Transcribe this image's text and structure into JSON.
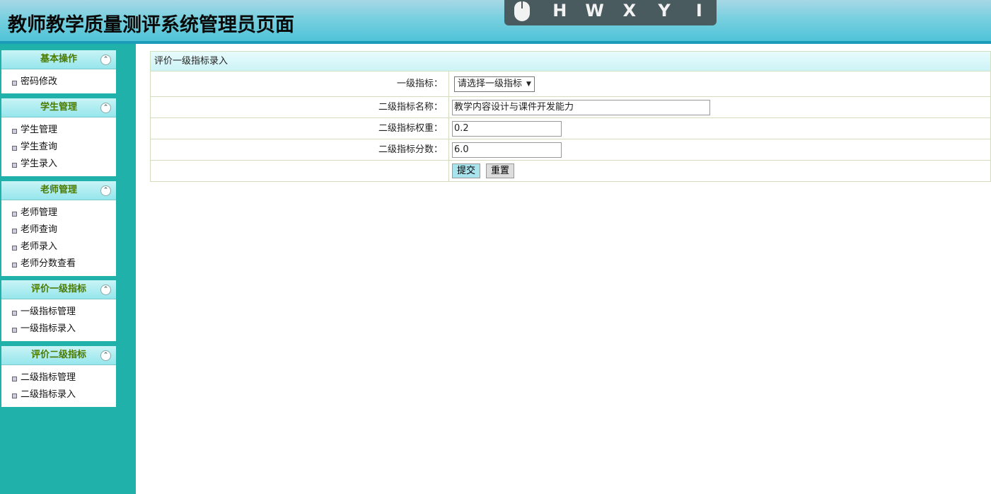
{
  "header": {
    "title": "教师教学质量测评系统管理员页面"
  },
  "kb_overlay": {
    "icon": "mouse-icon",
    "keys": [
      "H",
      "W",
      "X",
      "Y",
      "I"
    ]
  },
  "sidebar": {
    "panels": [
      {
        "title": "基本操作",
        "items": [
          "密码修改"
        ]
      },
      {
        "title": "学生管理",
        "items": [
          "学生管理",
          "学生查询",
          "学生录入"
        ]
      },
      {
        "title": "老师管理",
        "items": [
          "老师管理",
          "老师查询",
          "老师录入",
          "老师分数查看"
        ]
      },
      {
        "title": "评价一级指标",
        "items": [
          "一级指标管理",
          "一级指标录入"
        ]
      },
      {
        "title": "评价二级指标",
        "items": [
          "二级指标管理",
          "二级指标录入"
        ]
      }
    ]
  },
  "form": {
    "caption": "评价一级指标录入",
    "level1_label": "一级指标：",
    "level1_select": "请选择一级指标",
    "name_label": "二级指标名称：",
    "name_value": "教学内容设计与课件开发能力",
    "weight_label": "二级指标权重：",
    "weight_value": "0.2",
    "score_label": "二级指标分数：",
    "score_value": "6.0",
    "submit_label": "提交",
    "reset_label": "重置"
  },
  "colors": {
    "sidebar_bg": "#20b2aa",
    "header_border": "#1b9bb8",
    "panel_title": "#4b7a00"
  }
}
